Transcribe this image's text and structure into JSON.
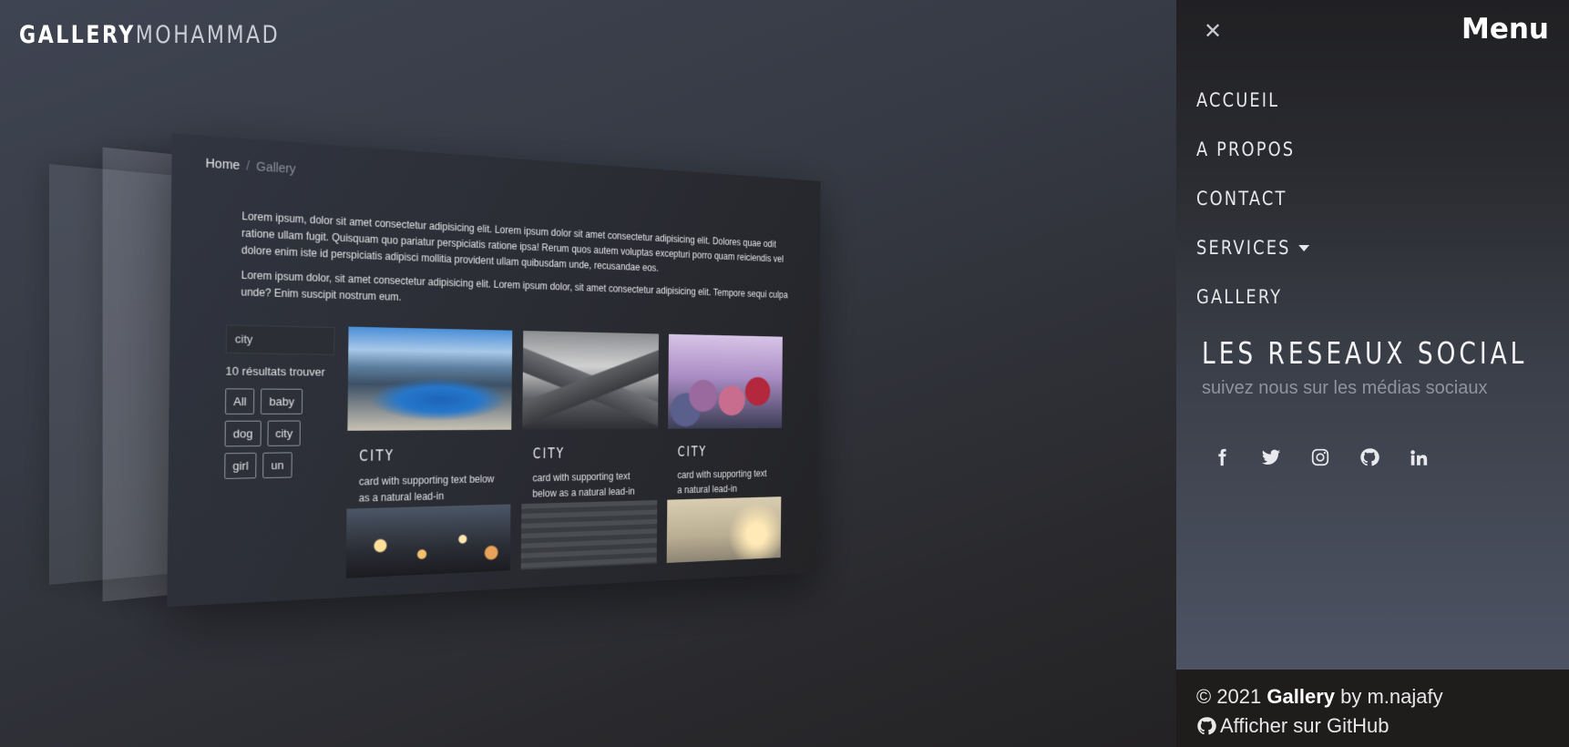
{
  "brand": {
    "bold": "GALLERY",
    "light": "MOHAMMAD"
  },
  "breadcrumb": {
    "home": "Home",
    "separator": "/",
    "current": "Gallery"
  },
  "intro": [
    "Lorem ipsum, dolor sit amet consectetur adipisicing elit. Lorem ipsum dolor sit amet consectetur adipisicing elit. Dolores quae odit ratione ullam fugit. Quisquam quo pariatur perspiciatis ratione ipsa! Rerum quos autem voluptas excepturi porro quam reiciendis vel dolore enim iste id perspiciatis adipisci mollitia provident ullam quibusdam unde, recusandae eos.",
    "Lorem ipsum dolor, sit amet consectetur adipisicing elit. Lorem ipsum dolor, sit amet consectetur adipisicing elit. Tempore sequi culpa unde? Enim suscipit nostrum eum."
  ],
  "filter": {
    "search_value": "city",
    "results": "10 résultats trouver",
    "tags": [
      "All",
      "baby",
      "dog",
      "city",
      "girl",
      "un"
    ]
  },
  "cards": [
    {
      "title": "CITY",
      "text": "card with supporting text below as a natural lead-in",
      "image": "fjord-lake"
    },
    {
      "title": "CITY",
      "text": "card with supporting text below as a natural lead-in",
      "image": "matterhorn-mountain"
    },
    {
      "title": "CITY",
      "text": "card with supporting text a natural lead-in",
      "image": "frozen-berries"
    }
  ],
  "row2_images": [
    "city-bokeh",
    "stone-stairs-biker",
    "misty-field"
  ],
  "menu": {
    "title": "Menu",
    "items": [
      {
        "label": "ACCUEIL"
      },
      {
        "label": "A PROPOS"
      },
      {
        "label": "CONTACT"
      },
      {
        "label": "SERVICES",
        "dropdown": true
      },
      {
        "label": "GALLERY"
      }
    ],
    "social_heading": "LES RESEAUX SOCIAL",
    "social_sub": "suivez nous sur les médias sociaux",
    "social_icons": [
      "facebook-icon",
      "twitter-icon",
      "instagram-icon",
      "github-icon",
      "linkedin-icon"
    ]
  },
  "footer": {
    "copyright": "© 2021",
    "brand": "Gallery",
    "by": "by m.najafy",
    "github_link": "Afficher sur GitHub"
  }
}
